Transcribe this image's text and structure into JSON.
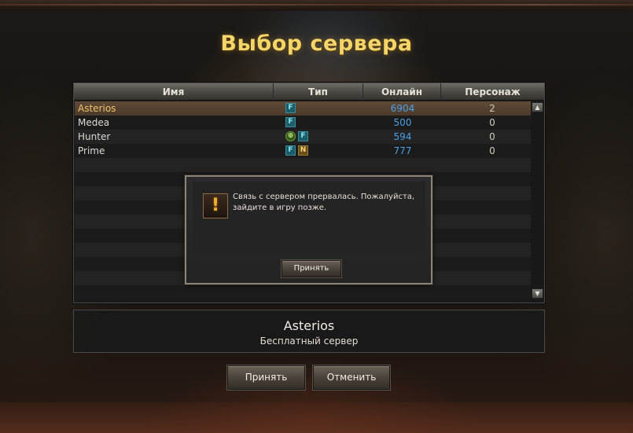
{
  "window": {
    "title": "Выбор сервера"
  },
  "server_list": {
    "columns": [
      "Имя",
      "Тип",
      "Онлайн",
      "Персонаж"
    ],
    "rows": [
      {
        "name": "Asterios",
        "types": [
          "F"
        ],
        "online": "6904",
        "characters": "2",
        "selected": true
      },
      {
        "name": "Medea",
        "types": [
          "F"
        ],
        "online": "500",
        "characters": "0",
        "selected": false
      },
      {
        "name": "Hunter",
        "types": [
          "PvP",
          "F"
        ],
        "online": "594",
        "characters": "0",
        "selected": false
      },
      {
        "name": "Prime",
        "types": [
          "F",
          "N"
        ],
        "online": "777",
        "characters": "0",
        "selected": false
      }
    ],
    "scroll_up_icon": "arrow-up-icon",
    "scroll_down_icon": "arrow-down-icon"
  },
  "selected_server": {
    "name": "Asterios",
    "description": "Бесплатный сервер"
  },
  "buttons": {
    "accept": "Принять",
    "cancel": "Отменить"
  },
  "dialog": {
    "icon": "warning-icon",
    "message": "Связь с сервером прервалась. Пожалуйста, зайдите в игру позже.",
    "ok": "Принять"
  },
  "colors": {
    "title": "#f4d56a",
    "selected_name": "#f0c46a",
    "online": "#4aa0e6",
    "type_f": "#1c5d6a",
    "type_n": "#6a4e1a",
    "type_pvp": "#355a1c"
  }
}
